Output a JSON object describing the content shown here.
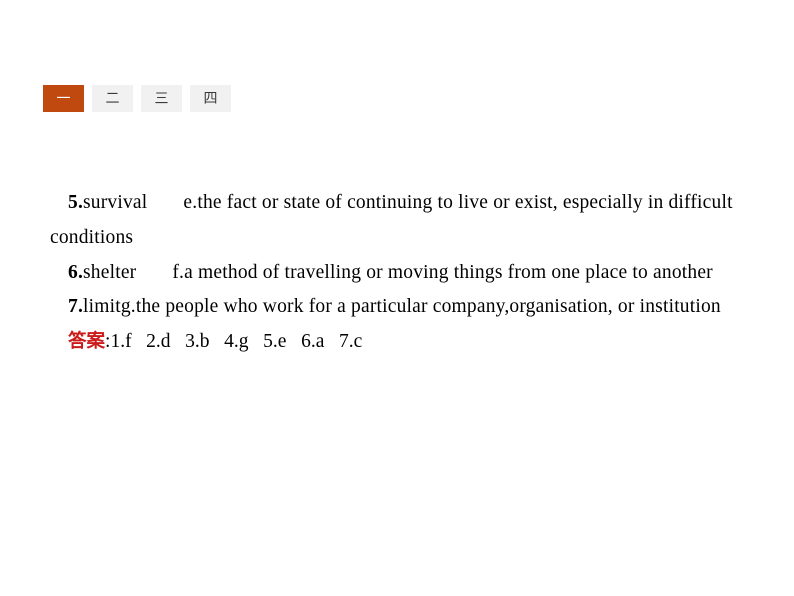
{
  "tabs": [
    {
      "label": "一",
      "active": true
    },
    {
      "label": "二",
      "active": false
    },
    {
      "label": "三",
      "active": false
    },
    {
      "label": "四",
      "active": false
    }
  ],
  "colors": {
    "active_tab_bg": "#c0490f",
    "active_tab_text": "#ffffff",
    "inactive_tab_bg": "#f1f1f1",
    "inactive_tab_text": "#3a3a3a",
    "answer_label": "#cc1a1a",
    "body_text": "#000000",
    "page_bg": "#ffffff"
  },
  "entries": [
    {
      "number": "5.",
      "word": "survival",
      "letter": "e.",
      "definition": "the fact or state of continuing to live or exist, especially in difficult conditions"
    },
    {
      "number": "6.",
      "word": "shelter",
      "letter": "f.",
      "definition": "a method of travelling or moving things from one place to another"
    },
    {
      "number": "7.",
      "word": "limit",
      "letter": "g.",
      "definition": "the people who work for a particular company,organisation, or institution"
    }
  ],
  "answer": {
    "label": "答案",
    "colon": ":",
    "items": [
      "1.f",
      "2.d",
      "3.b",
      "4.g",
      "5.e",
      "6.a",
      "7.c"
    ],
    "text": "1.f   2.d   3.b   4.g   5.e   6.a   7.c"
  }
}
